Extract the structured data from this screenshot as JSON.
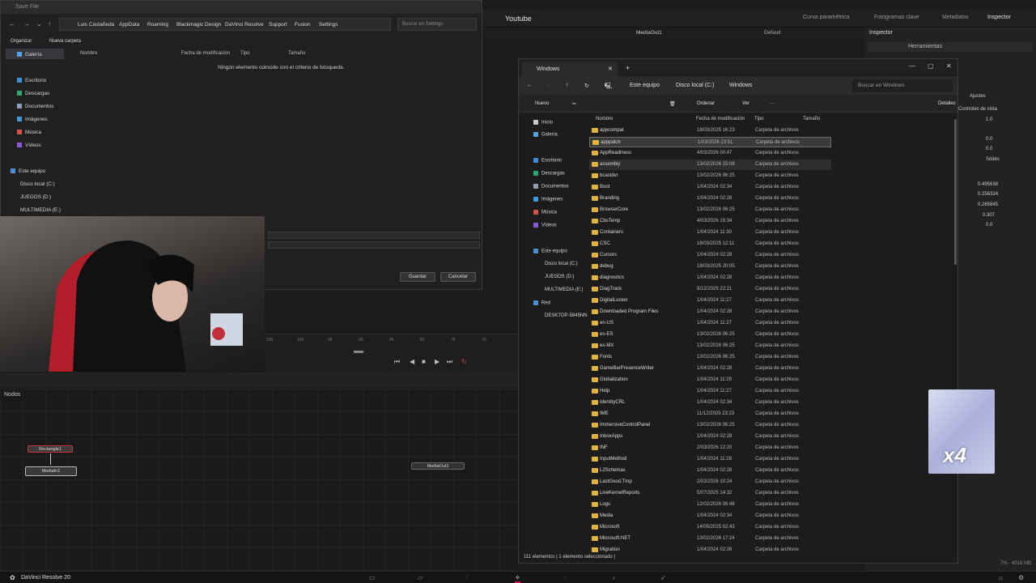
{
  "resolve": {
    "project_title": "Youtube",
    "toolbar": [
      "Curva paramétrica",
      "Fotogramas clave",
      "Metadatos",
      "Inspector"
    ],
    "viewer_label": "MediaOut1",
    "viewer_default": "Default",
    "inspector_title": "Inspector",
    "inspector_tab": "Herramientas",
    "inspector_controls": "Controles de vista",
    "inspector_ajustes": "Ajustes",
    "inspector_solido": "Sólido",
    "inspector_values": [
      "1.0",
      "0.0",
      "0.0",
      "0.495638",
      "0.256324",
      "0.265845",
      "0.307",
      "0.0"
    ],
    "timeline_ticks": [
      "105",
      "100",
      "95",
      "90",
      "85",
      "80",
      "75",
      "70"
    ],
    "nodes_label": "Nodos",
    "nodes": [
      "Rectangle1",
      "MediaIn1",
      "MediaOut1"
    ],
    "app_name": "DaVinci Resolve 20",
    "memory": "7% · 4518 MB"
  },
  "save_dialog": {
    "title": "Save File",
    "breadcrumb": [
      "Luis Castañeda",
      "AppData",
      "Roaming",
      "Blackmagic Design",
      "DaVinci Resolve",
      "Support",
      "Fusion",
      "Settings"
    ],
    "search_placeholder": "Buscar en Settings",
    "organize": "Organizar",
    "new_folder": "Nueva carpeta",
    "sidebar": [
      "Galería",
      "Escritorio",
      "Descargas",
      "Documentos",
      "Imágenes",
      "Música",
      "Vídeos",
      "Este equipo",
      "Disco local (C:)",
      "JUEGOS (D:)",
      "MULTIMEDIA (E:)"
    ],
    "columns": [
      "Nombre",
      "Fecha de modificación",
      "Tipo",
      "Tamaño"
    ],
    "empty_message": "Ningún elemento coincide con el criterio de búsqueda.",
    "save_button": "Guardar",
    "cancel_button": "Cancelar"
  },
  "explorer": {
    "tab_title": "Windows",
    "breadcrumb": [
      "Este equipo",
      "Disco local (C:)",
      "Windows"
    ],
    "search_placeholder": "Buscar en Windows",
    "commands": {
      "new": "Nuevo",
      "sort": "Ordenar",
      "view": "Ver",
      "details": "Detalles"
    },
    "sidebar": [
      "Inicio",
      "Galería",
      "Escritorio",
      "Descargas",
      "Documentos",
      "Imágenes",
      "Música",
      "Vídeos",
      "Este equipo",
      "Disco local (C:)",
      "JUEGOS (D:)",
      "MULTIMEDIA (E:)",
      "Red",
      "DESKTOP-5845NN"
    ],
    "columns": [
      "Nombre",
      "Fecha de modificación",
      "Tipo",
      "Tamaño"
    ],
    "files": [
      {
        "name": "appcompat",
        "date": "18/03/2025 16:23",
        "type": "Carpeta de archivos"
      },
      {
        "name": "apppatch",
        "date": "1/03/2026 23:51",
        "type": "Carpeta de archivos"
      },
      {
        "name": "AppReadiness",
        "date": "4/03/2026 00:47",
        "type": "Carpeta de archivos"
      },
      {
        "name": "assembly",
        "date": "13/02/2026 15:08",
        "type": "Carpeta de archivos"
      },
      {
        "name": "bcastdvr",
        "date": "13/02/2026 06:25",
        "type": "Carpeta de archivos"
      },
      {
        "name": "Boot",
        "date": "1/04/2024 02:34",
        "type": "Carpeta de archivos"
      },
      {
        "name": "Branding",
        "date": "1/04/2024 02:28",
        "type": "Carpeta de archivos"
      },
      {
        "name": "BrowserCore",
        "date": "13/02/2026 06:25",
        "type": "Carpeta de archivos"
      },
      {
        "name": "CbsTemp",
        "date": "4/03/2026 19:34",
        "type": "Carpeta de archivos"
      },
      {
        "name": "Containers",
        "date": "1/04/2024 11:30",
        "type": "Carpeta de archivos"
      },
      {
        "name": "CSC",
        "date": "18/03/2025 12:11",
        "type": "Carpeta de archivos"
      },
      {
        "name": "Cursors",
        "date": "1/04/2024 02:28",
        "type": "Carpeta de archivos"
      },
      {
        "name": "debug",
        "date": "18/03/2025 20:05",
        "type": "Carpeta de archivos"
      },
      {
        "name": "diagnostics",
        "date": "1/04/2024 02:28",
        "type": "Carpeta de archivos"
      },
      {
        "name": "DiagTrack",
        "date": "9/12/2025 22:21",
        "type": "Carpeta de archivos"
      },
      {
        "name": "DigitalLocker",
        "date": "1/04/2024 11:27",
        "type": "Carpeta de archivos"
      },
      {
        "name": "Downloaded Program Files",
        "date": "1/04/2024 02:28",
        "type": "Carpeta de archivos"
      },
      {
        "name": "en-US",
        "date": "1/04/2024 11:27",
        "type": "Carpeta de archivos"
      },
      {
        "name": "es-ES",
        "date": "13/02/2026 06:25",
        "type": "Carpeta de archivos"
      },
      {
        "name": "es-MX",
        "date": "13/02/2026 06:25",
        "type": "Carpeta de archivos"
      },
      {
        "name": "Fonts",
        "date": "13/02/2026 06:25",
        "type": "Carpeta de archivos"
      },
      {
        "name": "GameBarPresenceWriter",
        "date": "1/04/2024 02:28",
        "type": "Carpeta de archivos"
      },
      {
        "name": "Globalization",
        "date": "1/04/2024 11:29",
        "type": "Carpeta de archivos"
      },
      {
        "name": "Help",
        "date": "1/04/2024 11:27",
        "type": "Carpeta de archivos"
      },
      {
        "name": "IdentityCRL",
        "date": "1/04/2024 02:34",
        "type": "Carpeta de archivos"
      },
      {
        "name": "IME",
        "date": "11/12/2025 23:23",
        "type": "Carpeta de archivos"
      },
      {
        "name": "ImmersiveControlPanel",
        "date": "13/02/2026 06:25",
        "type": "Carpeta de archivos"
      },
      {
        "name": "InboxApps",
        "date": "1/04/2024 02:28",
        "type": "Carpeta de archivos"
      },
      {
        "name": "INF",
        "date": "2/03/2026 12:20",
        "type": "Carpeta de archivos"
      },
      {
        "name": "InputMethod",
        "date": "1/04/2024 11:28",
        "type": "Carpeta de archivos"
      },
      {
        "name": "L2Schemas",
        "date": "1/04/2024 02:28",
        "type": "Carpeta de archivos"
      },
      {
        "name": "LastGood.Tmp",
        "date": "2/03/2026 10:24",
        "type": "Carpeta de archivos"
      },
      {
        "name": "LiveKernelReports",
        "date": "5/07/2025 14:32",
        "type": "Carpeta de archivos"
      },
      {
        "name": "Logs",
        "date": "12/02/2026 06:46",
        "type": "Carpeta de archivos"
      },
      {
        "name": "Media",
        "date": "1/04/2024 02:34",
        "type": "Carpeta de archivos"
      },
      {
        "name": "Microsoft",
        "date": "14/05/2025 02:43",
        "type": "Carpeta de archivos"
      },
      {
        "name": "Microsoft.NET",
        "date": "13/02/2026 17:24",
        "type": "Carpeta de archivos"
      },
      {
        "name": "Migration",
        "date": "1/04/2024 02:26",
        "type": "Carpeta de archivos"
      }
    ],
    "status": "111 elementos  |  1 elemento seleccionado  |"
  },
  "overlay": {
    "label": "x4"
  }
}
